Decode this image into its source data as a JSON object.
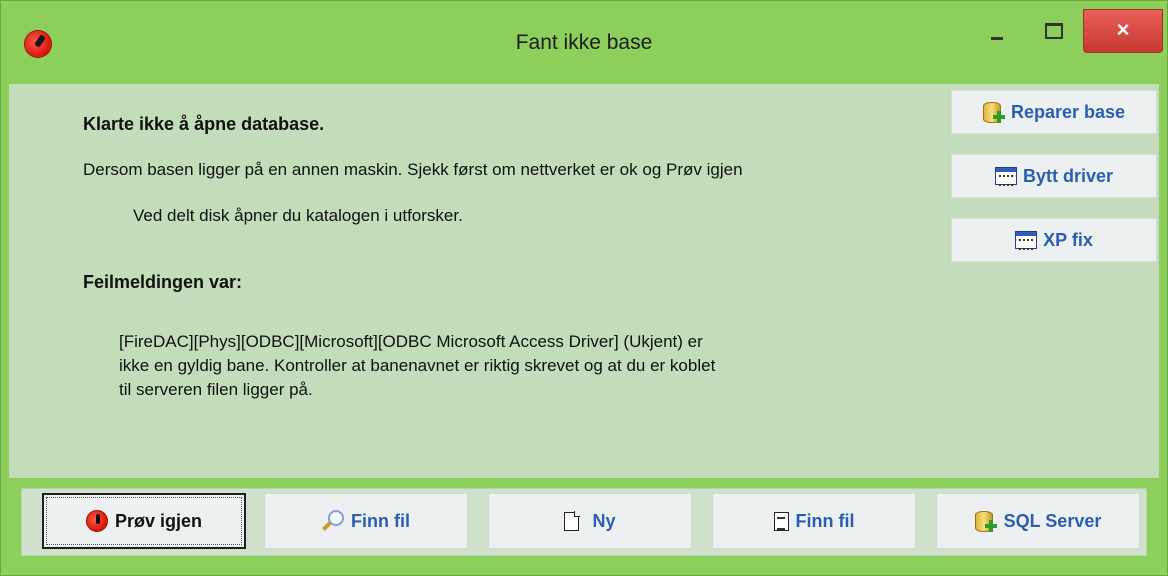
{
  "window": {
    "title": "Fant ikke base",
    "close_glyph": "×"
  },
  "message": {
    "heading": "Klarte ikke å åpne database.",
    "line1": "Dersom basen ligger på en annen maskin. Sjekk først  om  nettverket er ok og Prøv igjen",
    "line2": "Ved delt disk  åpner du katalogen i utforsker.",
    "error_heading": "Feilmeldingen var:",
    "error_lines": [
      "[FireDAC][Phys][ODBC][Microsoft][ODBC Microsoft Access Driver] (Ukjent) er",
      "ikke en gyldig bane. Kontroller at banenavnet er riktig skrevet og at du er koblet",
      "til serveren filen ligger på."
    ]
  },
  "side_buttons": {
    "repair": "Reparer base",
    "switch_driver": "Bytt driver",
    "xp_fix": "XP fix"
  },
  "bottom_buttons": {
    "retry": "Prøv igjen",
    "find_file": "Finn fil",
    "new": "Ny",
    "find_file_2": "Finn fil",
    "sql_server": "SQL Server"
  },
  "colors": {
    "frame": "#8ccf5b",
    "client": "#c3ddbb",
    "button_text": "#2a5db3",
    "close": "#c7392f"
  },
  "icons": [
    "app-icon",
    "minimize-icon",
    "maximize-icon",
    "close-icon",
    "database-add-icon",
    "driver-window-icon",
    "retry-icon",
    "magnifier-icon",
    "new-document-icon",
    "text-document-icon"
  ]
}
